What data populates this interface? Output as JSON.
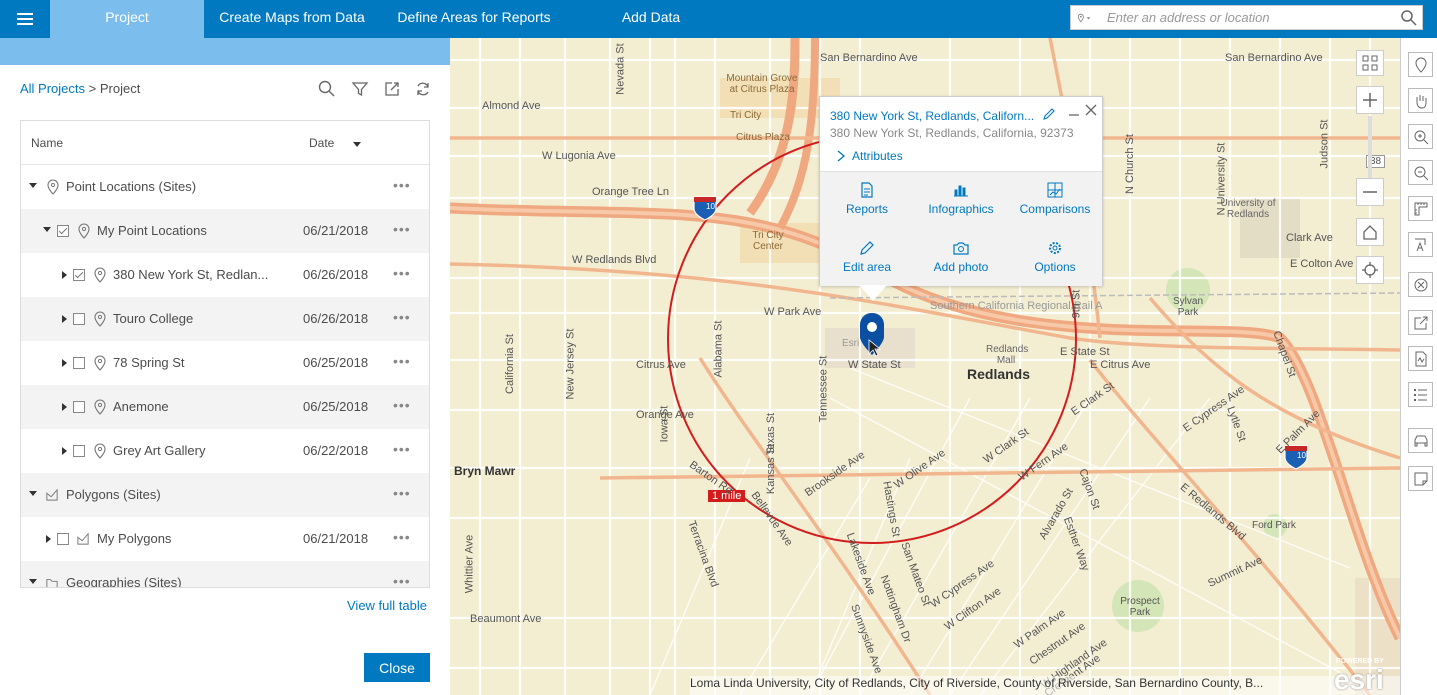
{
  "topbar": {
    "tabs": [
      "Project",
      "Create Maps from Data",
      "Define Areas for Reports",
      "Add Data"
    ],
    "search_placeholder": "Enter an address or location"
  },
  "panel": {
    "breadcrumb_link": "All Projects",
    "breadcrumb_sep": " > ",
    "breadcrumb_current": "Project",
    "col_name": "Name",
    "col_date": "Date",
    "rows": [
      {
        "label": "Point Locations (Sites)",
        "date": ""
      },
      {
        "label": "My Point Locations",
        "date": "06/21/2018"
      },
      {
        "label": "380 New York St, Redlan...",
        "date": "06/26/2018"
      },
      {
        "label": "Touro College",
        "date": "06/26/2018"
      },
      {
        "label": "78 Spring St",
        "date": "06/25/2018"
      },
      {
        "label": "Anemone",
        "date": "06/25/2018"
      },
      {
        "label": "Grey Art Gallery",
        "date": "06/22/2018"
      },
      {
        "label": "Polygons (Sites)",
        "date": ""
      },
      {
        "label": "My Polygons",
        "date": "06/21/2018"
      },
      {
        "label": "Geographies (Sites)",
        "date": ""
      }
    ],
    "more_label": "•••",
    "view_full_table": "View full table",
    "close_label": "Close"
  },
  "popup": {
    "title": "380 New York St, Redlands, Californ...",
    "address": "380 New York St, Redlands, California, 92373",
    "attributes": "Attributes",
    "actions": [
      "Reports",
      "Infographics",
      "Comparisons",
      "Edit area",
      "Add photo",
      "Options"
    ]
  },
  "map": {
    "ring_label": "1 mile",
    "city": "Redlands",
    "labels": [
      "San Bernardino Ave",
      "Almond Ave",
      "W Lugonia Ave",
      "Orange Tree Ln",
      "W Redlands Blvd",
      "W Park Ave",
      "Citrus Ave",
      "W State St",
      "Orange Ave",
      "Bryn Mawr",
      "Beaumont Ave",
      "Brookside Ave",
      "W Olive Ave",
      "W Clark St",
      "W Fern Ave",
      "E State St",
      "E Citrus Ave",
      "E Clark St",
      "E Cypress Ave",
      "E Palm Ave",
      "E Redlands Blvd",
      "Summit Ave",
      "Clark Ave",
      "E Colton Ave",
      "Ford Park",
      "Prospect Park",
      "Sylvan Park",
      "University of Redlands",
      "Tri City Center",
      "Citrus Plaza",
      "Mountain Grove at Citrus Plaza",
      "Redlands Mall",
      "Esri",
      "Southern California Regional Rail A",
      "W Cypress Ave",
      "W Clifton Ave",
      "W Palm Ave",
      "Chestnut Ave",
      "W Highland Ave",
      "Crescent Ave",
      "Alvarado St",
      "Cajon St",
      "N Church St",
      "N University St",
      "Judson St",
      "Tennessee St",
      "Alabama St",
      "Nevada St",
      "New Jersey St",
      "California St",
      "Texas St",
      "Kansas St",
      "Iowa St",
      "Terracina Blvd",
      "Whittier Ave",
      "Lakeside Ave",
      "Nottingham Dr",
      "San Mateo St",
      "Hastings St",
      "Esther Way",
      "Barton Rd",
      "Bellevue Ave",
      "Sunnyside Ave",
      "Lytle St",
      "Chapel St",
      "9th St",
      "Tri City"
    ],
    "interstate": "10",
    "route": "38",
    "attribution": "Loma Linda University, City of Redlands, City of Riverside, County of Riverside, San Bernardino County, B...",
    "logo_small": "POWERED BY",
    "logo": "esri"
  },
  "colors": {
    "accent": "#0079c1",
    "subbar": "#7bbdec",
    "ring": "#d31d1d",
    "road": "#f0a880",
    "map_bg": "#f3eed2"
  }
}
